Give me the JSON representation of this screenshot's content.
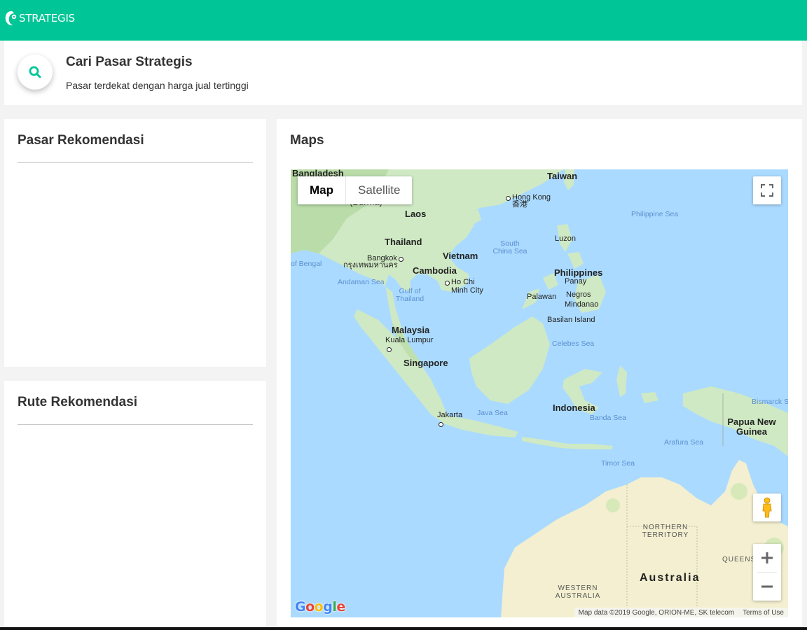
{
  "brand": {
    "name": "STRATEGIS",
    "color": "#00c596"
  },
  "header": {
    "title": "Cari Pasar Strategis",
    "subtitle": "Pasar terdekat dengan harga jual tertinggi",
    "icon": "search-icon"
  },
  "panels": {
    "pasar": {
      "title": "Pasar Rekomendasi"
    },
    "rute": {
      "title": "Rute Rekomendasi"
    },
    "maps": {
      "title": "Maps"
    }
  },
  "map": {
    "type_buttons": {
      "map": "Map",
      "satellite": "Satellite",
      "selected": "Map"
    },
    "google": [
      "G",
      "o",
      "o",
      "g",
      "l",
      "e"
    ],
    "attribution": "Map data ©2019 Google, ORION-ME, SK telecom",
    "terms": "Terms of Use",
    "labels": {
      "bangladesh": "Bangladesh",
      "burma": "(Burma)",
      "taiwan": "Taiwan",
      "hong_kong": "Hong Kong",
      "hong_kong_cjk": "香港",
      "laos": "Laos",
      "philippine_sea": "Philippine Sea",
      "thailand": "Thailand",
      "south_china_sea": "South China Sea",
      "luzon": "Luzon",
      "vietnam": "Vietnam",
      "bangkok": "Bangkok",
      "bangkok_thai": "กรุงเทพมหานคร",
      "bay_of_bengal": "of Bengal",
      "cambodia": "Cambodia",
      "philippines": "Philippines",
      "panay": "Panay",
      "andaman_sea": "Andaman Sea",
      "ho_chi_minh": "Ho Chi Minh City",
      "gulf_of_thailand": "Gulf of Thailand",
      "palawan": "Palawan",
      "negros": "Negros",
      "mindanao": "Mindanao",
      "basilan": "Basilan Island",
      "malaysia": "Malaysia",
      "kuala_lumpur": "Kuala Lumpur",
      "celebes_sea": "Celebes Sea",
      "singapore": "Singapore",
      "bismarck": "Bismarck S",
      "indonesia": "Indonesia",
      "jakarta": "Jakarta",
      "java_sea": "Java Sea",
      "banda_sea": "Banda Sea",
      "png": "Papua New Guinea",
      "arafura": "Arafura Sea",
      "timor": "Timor Sea",
      "northern_territory": "NORTHERN TERRITORY",
      "queensland": "QUEENS",
      "australia": "Australia",
      "western_australia": "WESTERN AUSTRALIA"
    }
  }
}
